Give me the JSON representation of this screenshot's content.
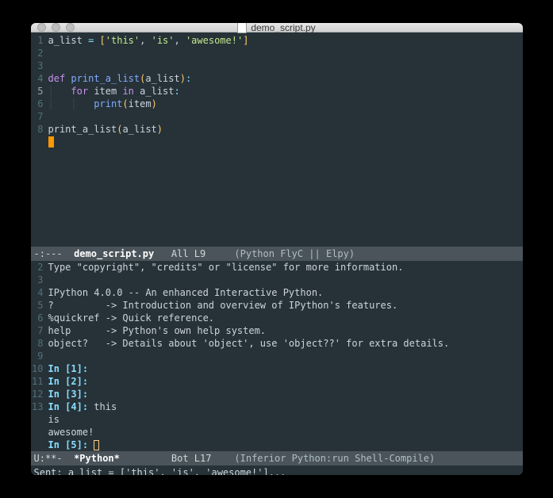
{
  "title": "demo_script.py",
  "editor": {
    "lines": [
      "1",
      "2",
      "3",
      "4",
      "5",
      "6",
      "7",
      "8"
    ],
    "current_line": "5",
    "code": {
      "l1_name": "a_list",
      "l1_eq": " = ",
      "l1_open": "[",
      "l1_s1": "'this'",
      "l1_c1": ", ",
      "l1_s2": "'is'",
      "l1_c2": ", ",
      "l1_s3": "'awesome!'",
      "l1_close": "]",
      "l4_def": "def",
      "l4_sp": " ",
      "l4_fn": "print_a_list",
      "l4_open": "(",
      "l4_arg": "a_list",
      "l4_close": ")",
      "l4_colon": ":",
      "l5_for": "for",
      "l5_item": " item ",
      "l5_in": "in",
      "l5_arg": " a_list",
      "l5_colon": ":",
      "l6_print": "print",
      "l6_open": "(",
      "l6_arg": "item",
      "l6_close": ")",
      "l8_call": "print_a_list",
      "l8_open": "(",
      "l8_arg": "a_list",
      "l8_close": ")"
    },
    "modeline": {
      "status": "-:---",
      "buffer": "  demo_script.py   ",
      "pos": "All L9     ",
      "modes": "(Python FlyC || Elpy)"
    }
  },
  "repl": {
    "lines": [
      "2",
      "3",
      "4",
      "5",
      "6",
      "7",
      "8",
      "9",
      "10",
      "11",
      "12",
      "13"
    ],
    "text": {
      "l2": "Type \"copyright\", \"credits\" or \"license\" for more information.",
      "l4": "IPython 4.0.0 -- An enhanced Interactive Python.",
      "l5": "?         -> Introduction and overview of IPython's features.",
      "l6": "%quickref -> Quick reference.",
      "l7": "help      -> Python's own help system.",
      "l8": "object?   -> Details about 'object', use 'object??' for extra details.",
      "p1": "In [1]:",
      "p2": "In [2]:",
      "p3": "In [3]:",
      "p4": "In [4]: ",
      "p4_out1": "this",
      "p4_out2": "is",
      "p4_out3": "awesome!",
      "p5": "In [5]: "
    },
    "modeline": {
      "status": "U:**-",
      "buffer": "  *Python*         ",
      "pos": "Bot L17    ",
      "modes": "(Inferior Python:run Shell-Compile)"
    }
  },
  "minibuffer": "Sent: a_list = ['this', 'is', 'awesome!']..."
}
